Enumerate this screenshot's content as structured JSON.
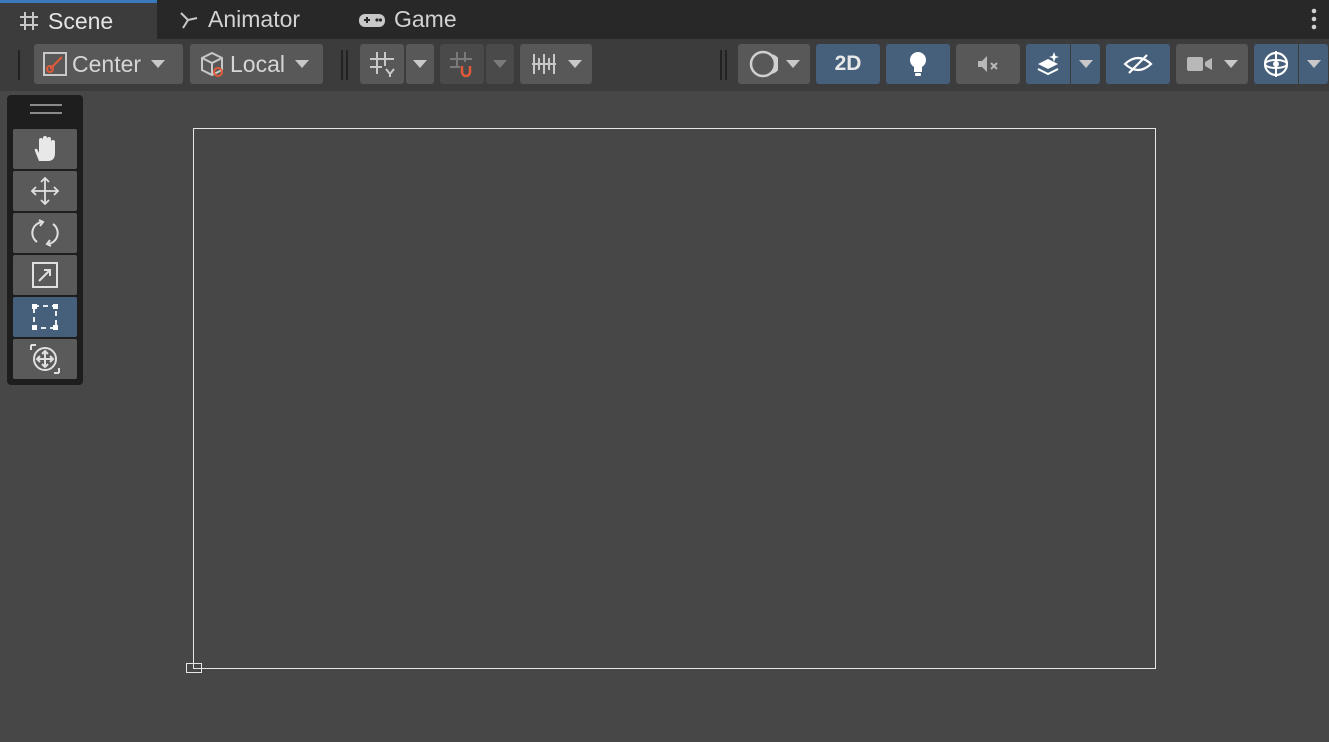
{
  "tabs": [
    {
      "label": "Scene",
      "icon": "grid-icon",
      "active": true
    },
    {
      "label": "Animator",
      "icon": "animator-icon",
      "active": false
    },
    {
      "label": "Game",
      "icon": "gamepad-icon",
      "active": false
    }
  ],
  "toolbar": {
    "pivot_label": "Center",
    "rotation_label": "Local",
    "mode_2d_label": "2D"
  },
  "tools": [
    "hand-tool",
    "move-tool",
    "rotate-tool",
    "scale-tool",
    "rect-tool",
    "transform-tool"
  ],
  "selected_tool": "rect-tool",
  "colors": {
    "accent_blue": "#46607c",
    "tab_highlight": "#3a79bb",
    "snap_orange": "#e05a3a"
  }
}
